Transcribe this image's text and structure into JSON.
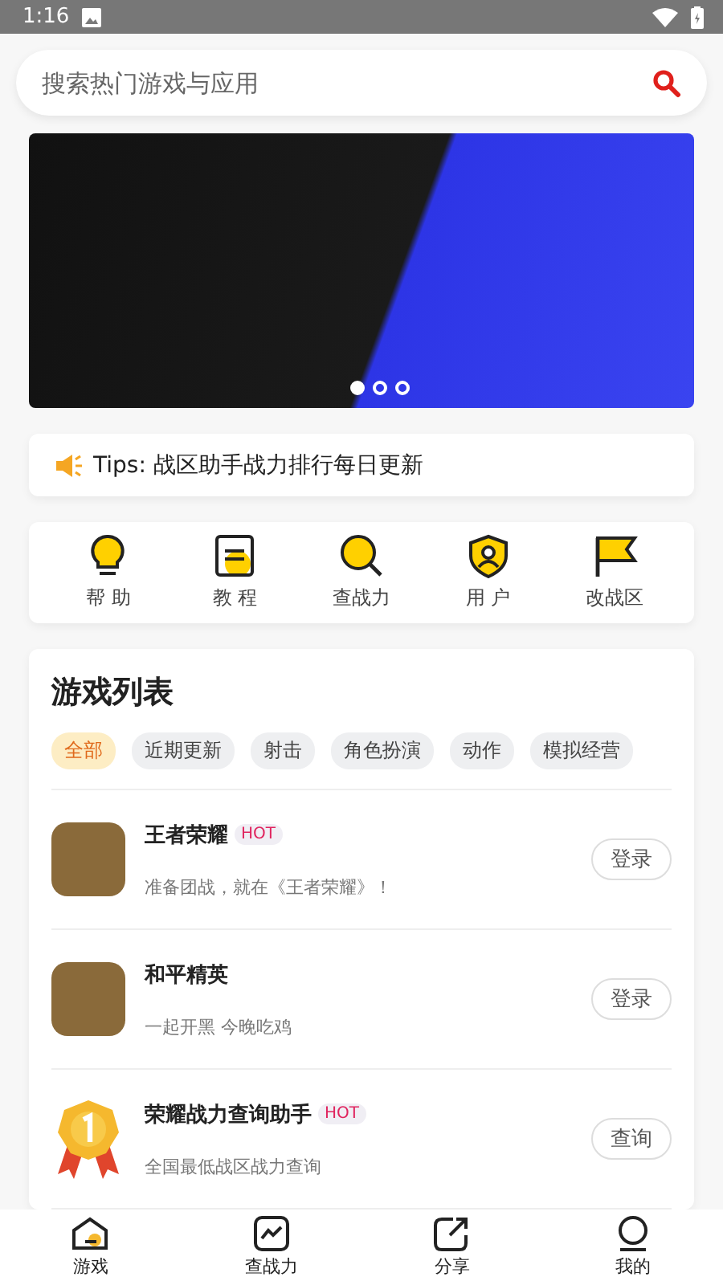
{
  "status_bar": {
    "time": "1:16"
  },
  "search": {
    "placeholder": "搜索热门游戏与应用"
  },
  "banner": {
    "dots": [
      {
        "selected": true
      },
      {
        "selected": false
      },
      {
        "selected": false
      }
    ]
  },
  "tips": {
    "text": "Tips: 战区助手战力排行每日更新"
  },
  "shortcuts": [
    {
      "label": "帮 助",
      "kind": "bulb"
    },
    {
      "label": "教 程",
      "kind": "doc"
    },
    {
      "label": "查战力",
      "kind": "search"
    },
    {
      "label": "用 户",
      "kind": "shield"
    },
    {
      "label": "改战区",
      "kind": "flag"
    }
  ],
  "game_list": {
    "title": "游戏列表",
    "filters": [
      {
        "label": "全部",
        "selected": true
      },
      {
        "label": "近期更新",
        "selected": false
      },
      {
        "label": "射击",
        "selected": false
      },
      {
        "label": "角色扮演",
        "selected": false
      },
      {
        "label": "动作",
        "selected": false
      },
      {
        "label": "模拟经营",
        "selected": false
      }
    ],
    "games": [
      {
        "name": "王者荣耀",
        "hot": true,
        "badge": "HOT",
        "description": "准备团战，就在《王者荣耀》！",
        "button": "登录",
        "kind": "photo"
      },
      {
        "name": "和平精英",
        "hot": false,
        "description": "一起开黑 今晚吃鸡",
        "button": "登录",
        "kind": "photo"
      },
      {
        "name": "荣耀战力查询助手",
        "hot": true,
        "badge": "HOT",
        "description": "全国最低战区战力查询",
        "button": "查询",
        "kind": "medal"
      }
    ]
  },
  "bottom_nav": [
    {
      "label": "游戏",
      "kind": "home",
      "selected": true
    },
    {
      "label": "查战力",
      "kind": "chart",
      "selected": false
    },
    {
      "label": "分享",
      "kind": "share",
      "selected": false
    },
    {
      "label": "我的",
      "kind": "user",
      "selected": false
    }
  ]
}
